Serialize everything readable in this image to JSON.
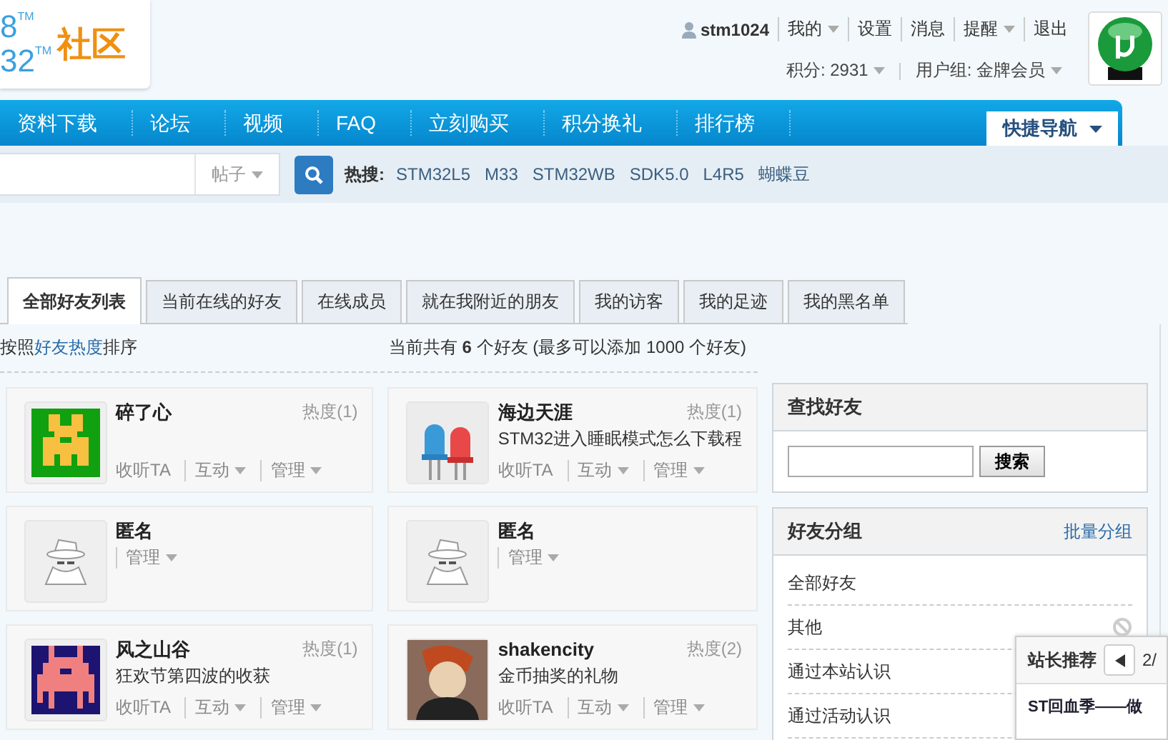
{
  "logo": {
    "lines": [
      {
        "text": "8",
        "mark": "TM"
      },
      {
        "text": "32",
        "mark": "TM"
      }
    ],
    "name": "社区"
  },
  "user_bar": {
    "username": "stm1024",
    "links": [
      {
        "label": "我的",
        "dropdown": true
      },
      {
        "label": "设置",
        "dropdown": false
      },
      {
        "label": "消息",
        "dropdown": false
      },
      {
        "label": "提醒",
        "dropdown": true
      },
      {
        "label": "退出",
        "dropdown": false
      }
    ],
    "points": "积分: 2931",
    "group": "用户组: 金牌会员"
  },
  "nav": {
    "items": [
      "资料下载",
      "论坛",
      "视频",
      "FAQ",
      "立刻购买",
      "积分换礼",
      "排行榜"
    ],
    "quick_nav": "快捷导航"
  },
  "search": {
    "type": "帖子",
    "hot_label": "热搜:",
    "hot": [
      "STM32L5",
      "M33",
      "STM32WB",
      "SDK5.0",
      "L4R5",
      "蝴蝶豆"
    ]
  },
  "tabs": [
    {
      "label": "全部好友列表",
      "selected": true
    },
    {
      "label": "当前在线的好友",
      "selected": false
    },
    {
      "label": "在线成员",
      "selected": false
    },
    {
      "label": "就在我附近的朋友",
      "selected": false
    },
    {
      "label": "我的访客",
      "selected": false
    },
    {
      "label": "我的足迹",
      "selected": false
    },
    {
      "label": "我的黑名单",
      "selected": false
    }
  ],
  "sort": {
    "prefix": "按照",
    "link": "好友热度",
    "suffix": "排序"
  },
  "count": "当前共有 **6** 个好友 (最多可以添加 1000 个好友)",
  "friends": [
    {
      "name": "碎了心",
      "heat": "热度(1)",
      "kind": "invader",
      "actions": [
        {
          "label": "收听TA",
          "dropdown": false
        },
        {
          "label": "互动",
          "dropdown": true
        },
        {
          "label": "管理",
          "dropdown": true
        }
      ]
    },
    {
      "name": "海边天涯",
      "heat": "热度(1)",
      "status": "STM32进入睡眠模式怎么下载程",
      "kind": "leds",
      "actions": [
        {
          "label": "收听TA",
          "dropdown": false
        },
        {
          "label": "互动",
          "dropdown": true
        },
        {
          "label": "管理",
          "dropdown": true
        }
      ]
    },
    {
      "name": "匿名",
      "kind": "anonymous",
      "actions": [
        {
          "label": "管理",
          "dropdown": true
        }
      ]
    },
    {
      "name": "匿名",
      "kind": "anonymous",
      "actions": [
        {
          "label": "管理",
          "dropdown": true
        }
      ]
    },
    {
      "name": "风之山谷",
      "heat": "热度(1)",
      "status": "狂欢节第四波的收获",
      "kind": "ship",
      "actions": [
        {
          "label": "收听TA",
          "dropdown": false
        },
        {
          "label": "互动",
          "dropdown": true
        },
        {
          "label": "管理",
          "dropdown": true
        }
      ]
    },
    {
      "name": "shakencity",
      "heat": "热度(2)",
      "status": "金币抽奖的礼物",
      "kind": "photo",
      "actions": [
        {
          "label": "收听TA",
          "dropdown": false
        },
        {
          "label": "互动",
          "dropdown": true
        },
        {
          "label": "管理",
          "dropdown": true
        }
      ]
    }
  ],
  "find_friend": {
    "title": "查找好友",
    "button": "搜索"
  },
  "groups": {
    "title": "好友分组",
    "action": "批量分组",
    "items": [
      {
        "label": "全部好友",
        "blocked": false
      },
      {
        "label": "其他",
        "blocked": true
      },
      {
        "label": "通过本站认识",
        "blocked": false
      },
      {
        "label": "通过活动认识",
        "blocked": false
      }
    ]
  },
  "popup": {
    "title": "站长推荐",
    "page": "2/",
    "item": "ST回血季——做"
  }
}
